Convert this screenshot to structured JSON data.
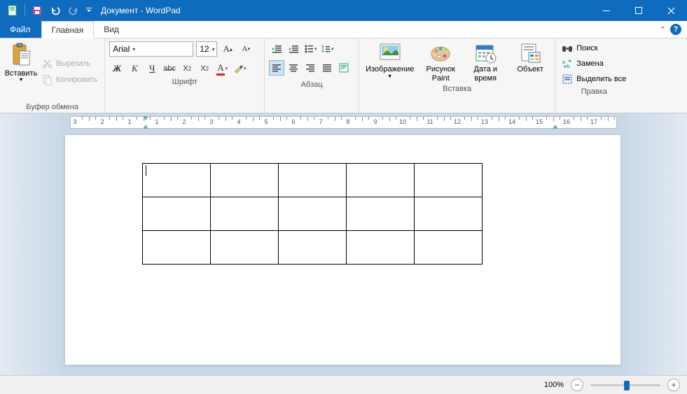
{
  "title": "Документ - WordPad",
  "tabs": {
    "file": "Файл",
    "home": "Главная",
    "view": "Вид"
  },
  "clipboard": {
    "paste": "Вставить",
    "cut": "Вырезать",
    "copy": "Копировать",
    "group": "Буфер обмена"
  },
  "font": {
    "family": "Arial",
    "size": "12",
    "group": "Шрифт"
  },
  "paragraph": {
    "group": "Абзац"
  },
  "insert": {
    "image": "Изображение",
    "paint": "Рисунок Paint",
    "datetime": "Дата и время",
    "object": "Объект",
    "group": "Вставка"
  },
  "editing": {
    "find": "Поиск",
    "replace": "Замена",
    "selectall": "Выделить все",
    "group": "Правка"
  },
  "ruler": {
    "numbers": [
      3,
      2,
      1,
      1,
      2,
      3,
      4,
      5,
      6,
      7,
      8,
      9,
      10,
      11,
      12,
      13,
      14,
      15,
      16,
      17
    ]
  },
  "document": {
    "table": {
      "rows": 3,
      "cols": 5
    }
  },
  "status": {
    "zoom": "100%"
  }
}
